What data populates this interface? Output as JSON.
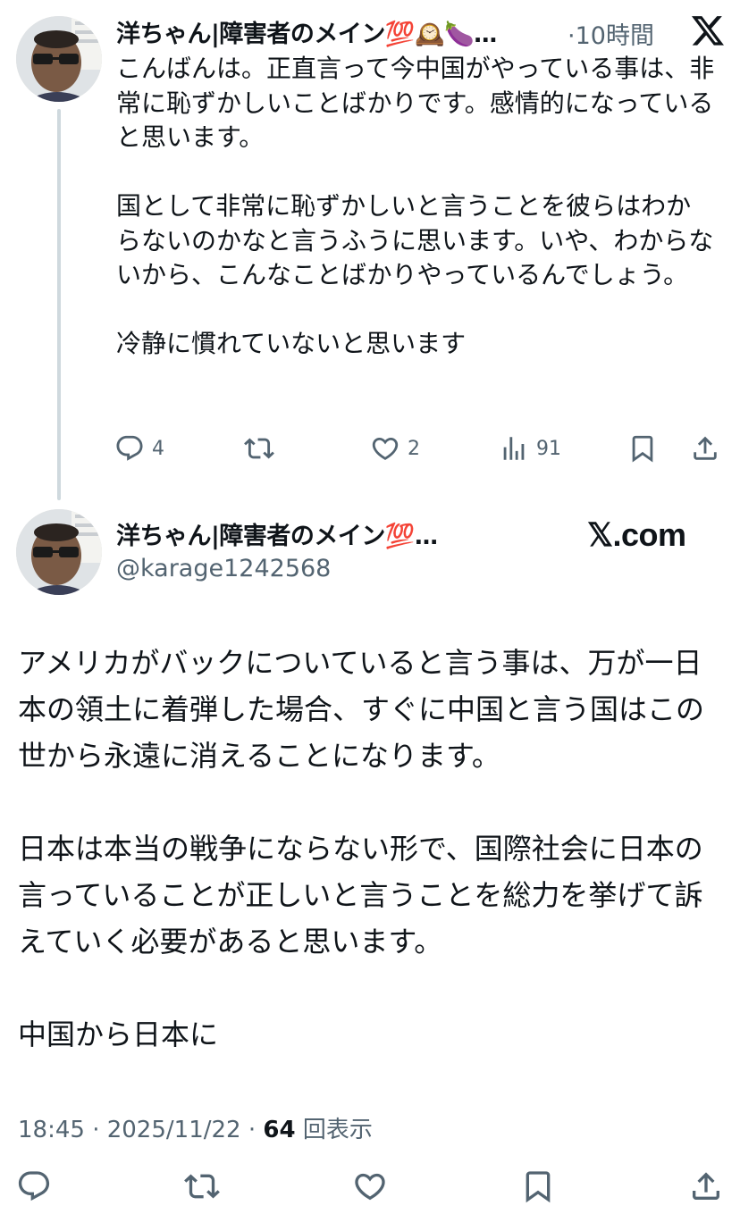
{
  "reply_tweet": {
    "display_name": "洋ちゃん|障害者のメイン",
    "name_emojis": "💯🕰️🍆",
    "ellipsis": "…",
    "time": "·10時間",
    "paragraphs": [
      "こんばんは。正直言って今中国がやっている事は、非常に恥ずかしいことばかりです。感情的になっていると思います。",
      "国として非常に恥ずかしいと言うことを彼らはわからないのかなと言うふうに思います。いや、わからないから、こんなことばかりやっているんでしょう。",
      "冷静に慣れていないと思います"
    ],
    "actions": {
      "reply_count": "4",
      "retweet_count": "",
      "like_count": "2",
      "view_count": "91"
    }
  },
  "main_tweet": {
    "display_name": "洋ちゃん|障害者のメイン",
    "name_emoji": "💯",
    "ellipsis": "…",
    "handle": "@karage1242568",
    "watermark": "𝕏.com",
    "paragraphs": [
      "アメリカがバックについていると言う事は、万が一日本の領土に着弾した場合、すぐに中国と言う国はこの世から永遠に消えることになります。",
      "日本は本当の戦争にならない形で、国際社会に日本の言っていることが正しいと言うことを総力を挙げて訴えていく必要があると思います。",
      "中国から日本に"
    ],
    "timestamp": "18:45 · 2025/11/22 · ",
    "views_number": "64",
    "views_label": " 回表示"
  },
  "colors": {
    "text": "#0f1419",
    "secondary": "#536471",
    "thread_line": "#cfd9de"
  },
  "icons": [
    "reply-icon",
    "retweet-icon",
    "like-icon",
    "views-icon",
    "bookmark-icon",
    "share-icon",
    "x-logo-icon",
    "avatar"
  ]
}
